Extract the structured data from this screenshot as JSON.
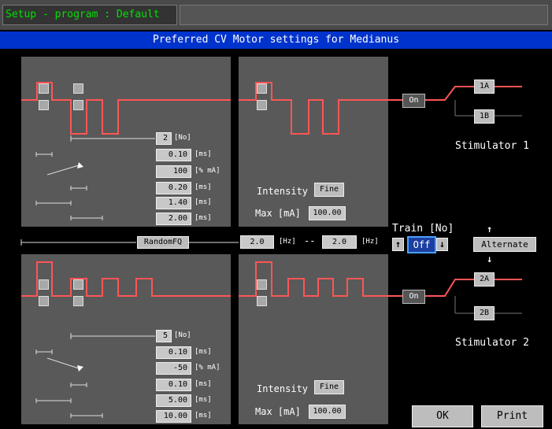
{
  "window": {
    "title": "Setup - program : Default"
  },
  "header": {
    "title": "Preferred CV Motor settings for Medianus"
  },
  "upper": {
    "values": [
      {
        "value": "2",
        "unit": "[No]"
      },
      {
        "value": "0.10",
        "unit": "[ms]"
      },
      {
        "value": "100",
        "unit": "[% mA]"
      },
      {
        "value": "0.20",
        "unit": "[ms]"
      },
      {
        "value": "1.40",
        "unit": "[ms]"
      },
      {
        "value": "2.00",
        "unit": "[ms]"
      }
    ],
    "intensity_label": "Intensity",
    "intensity_button": "Fine",
    "max_label": "Max [mA]",
    "max_value": "100.00",
    "on_label": "On",
    "out_a": "1A",
    "out_b": "1B",
    "stimulator": "Stimulator 1"
  },
  "middle": {
    "random_button": "RandomFQ",
    "hz_from": "2.0",
    "hz_from_unit": "[Hz]",
    "dash": "--",
    "hz_to": "2.0",
    "hz_to_unit": "[Hz]",
    "train_label": "Train [No]",
    "train_value": "Off",
    "alternate_button": "Alternate",
    "arrow_up": "↑",
    "arrow_down": "↓"
  },
  "lower": {
    "values": [
      {
        "value": "5",
        "unit": "[No]"
      },
      {
        "value": "0.10",
        "unit": "[ms]"
      },
      {
        "value": "-50",
        "unit": "[% mA]"
      },
      {
        "value": "0.10",
        "unit": "[ms]"
      },
      {
        "value": "5.00",
        "unit": "[ms]"
      },
      {
        "value": "10.00",
        "unit": "[ms]"
      }
    ],
    "intensity_label": "Intensity",
    "intensity_button": "Fine",
    "max_label": "Max [mA]",
    "max_value": "100.00",
    "on_label": "On",
    "out_a": "2A",
    "out_b": "2B",
    "stimulator": "Stimulator 2"
  },
  "footer": {
    "ok": "OK",
    "print": "Print"
  },
  "colors": {
    "waveform": "#ff5555",
    "header": "#0033cc",
    "title_text": "#00e000"
  }
}
